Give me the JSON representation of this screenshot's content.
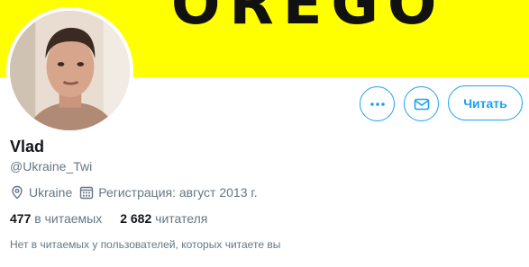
{
  "banner": {
    "art_text": "OREGO",
    "background": "#ffff00"
  },
  "profile": {
    "name": "Vlad",
    "handle": "@Ukraine_Twi",
    "location": "Ukraine",
    "joined": "Регистрация: август 2013 г."
  },
  "actions": {
    "more_icon": "more-horizontal-icon",
    "message_icon": "envelope-icon",
    "follow_label": "Читать"
  },
  "stats": {
    "following_count": "477",
    "following_label": "в читаемых",
    "followers_count": "2 682",
    "followers_label": "читателя"
  },
  "footnote": "Нет в читаемых у пользователей, которых читаете вы",
  "colors": {
    "accent": "#1da1f2",
    "secondary_text": "#657786",
    "primary_text": "#14171a"
  }
}
